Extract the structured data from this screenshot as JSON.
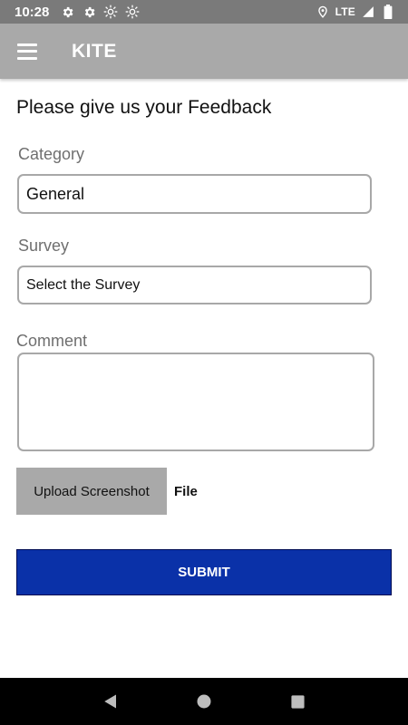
{
  "status_bar": {
    "time": "10:28",
    "network": "LTE",
    "icons": [
      "settings-icon",
      "settings-icon",
      "brightness-icon",
      "brightness-icon",
      "location-icon",
      "signal-icon",
      "battery-icon"
    ]
  },
  "app_bar": {
    "title": "KITE",
    "menu_icon": "hamburger-menu-icon"
  },
  "form": {
    "heading": "Please give us your Feedback",
    "category": {
      "label": "Category",
      "value": "General"
    },
    "survey": {
      "label": "Survey",
      "value": "Select the Survey"
    },
    "comment": {
      "label": "Comment",
      "value": ""
    },
    "upload_label": "Upload Screenshot",
    "file_label": "File",
    "submit_label": "SUBMIT"
  },
  "nav_bar": {
    "icons": [
      "back-icon",
      "home-icon",
      "recents-icon"
    ]
  },
  "colors": {
    "status_bar": "#7a7a7a",
    "app_bar": "#a9a9a9",
    "submit": "#0a31a8",
    "upload": "#a9a9a9",
    "field_border": "#a8a8a8",
    "nav_bar": "#000000"
  }
}
